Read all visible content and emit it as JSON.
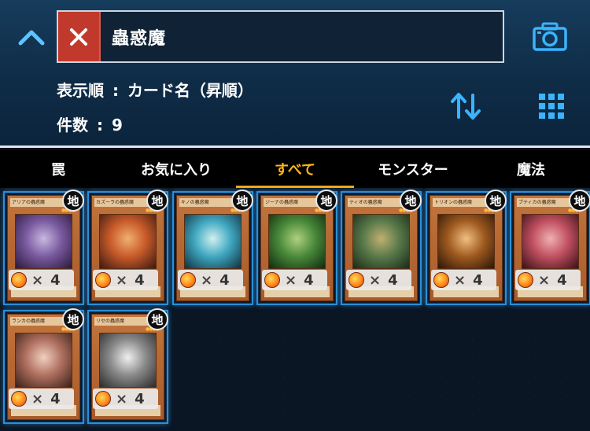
{
  "header": {
    "search_value": "蟲惑魔",
    "sort_label": "表示順",
    "sort_separator": ":",
    "sort_value": "カード名（昇順）",
    "count_label": "件数",
    "count_separator": ":",
    "count_value": "9"
  },
  "tabs": [
    {
      "label": "罠",
      "active": false
    },
    {
      "label": "お気に入り",
      "active": false
    },
    {
      "label": "すべて",
      "active": true
    },
    {
      "label": "モンスター",
      "active": false
    },
    {
      "label": "魔法",
      "active": false
    }
  ],
  "colors": {
    "accent": "#f3a61d",
    "card_border": "#2a8fd6",
    "clear_button": "#c1392d",
    "icon": "#3ab4ff"
  },
  "cards": [
    {
      "name": "アリアの蟲惑魔",
      "attribute": "地",
      "times": "×",
      "count": "4",
      "art": [
        "#2a1a3a",
        "#7a5aa0",
        "#c8b8e0"
      ]
    },
    {
      "name": "カズーラの蟲惑魔",
      "attribute": "地",
      "times": "×",
      "count": "4",
      "art": [
        "#3a1a10",
        "#c85a2a",
        "#f0b070"
      ]
    },
    {
      "name": "キノの蟲惑魔",
      "attribute": "地",
      "times": "×",
      "count": "4",
      "art": [
        "#103040",
        "#40a8c0",
        "#d0f0f0"
      ]
    },
    {
      "name": "ジーナの蟲惑魔",
      "attribute": "地",
      "times": "×",
      "count": "4",
      "art": [
        "#102a10",
        "#4a8a3a",
        "#b0d080"
      ]
    },
    {
      "name": "ティオの蟲惑魔",
      "attribute": "地",
      "times": "×",
      "count": "4",
      "art": [
        "#1a2a1a",
        "#5a7a4a",
        "#c0b070"
      ]
    },
    {
      "name": "トリオンの蟲惑魔",
      "attribute": "地",
      "times": "×",
      "count": "4",
      "art": [
        "#2a1608",
        "#a05a20",
        "#f0c080"
      ]
    },
    {
      "name": "プティカの蟲惑魔",
      "attribute": "地",
      "times": "×",
      "count": "4",
      "art": [
        "#3a1018",
        "#c05060",
        "#f0b0b0"
      ]
    },
    {
      "name": "ランカの蟲惑魔",
      "attribute": "地",
      "times": "×",
      "count": "4",
      "art": [
        "#3a2018",
        "#b07060",
        "#f0d0c0"
      ]
    },
    {
      "name": "リセの蟲惑魔",
      "attribute": "地",
      "times": "×",
      "count": "4",
      "art": [
        "#2a2a2a",
        "#8a8a8a",
        "#f0f0f0"
      ]
    }
  ],
  "icons": {
    "collapse": "chevron-up-icon",
    "clear": "close-icon",
    "camera": "camera-icon",
    "sort_toggle": "sort-direction-icon",
    "grid_view": "grid-view-icon",
    "count_orb": "orb-icon"
  }
}
